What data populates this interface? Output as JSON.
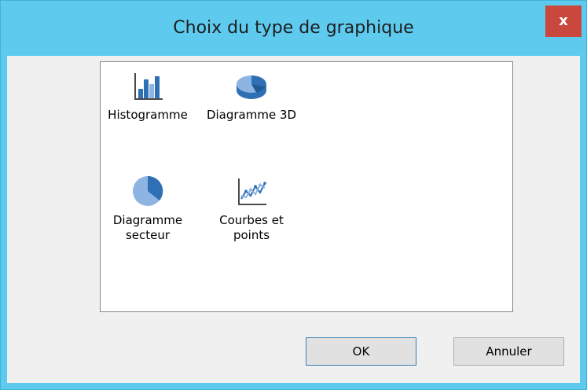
{
  "window": {
    "title": "Choix du type de graphique",
    "close_label": "x"
  },
  "chart_types": [
    {
      "label": "Histogramme",
      "icon": "bar-chart-icon"
    },
    {
      "label": "Diagramme 3D",
      "icon": "pie-3d-icon"
    },
    {
      "label": "Diagramme secteur",
      "icon": "pie-chart-icon"
    },
    {
      "label": "Courbes et points",
      "icon": "line-chart-icon"
    }
  ],
  "buttons": {
    "ok": "OK",
    "cancel": "Annuler"
  },
  "colors": {
    "titlebar": "#5ecbee",
    "close": "#c9473d",
    "icon_dark": "#2f6fb3",
    "icon_light": "#8db4e2"
  }
}
